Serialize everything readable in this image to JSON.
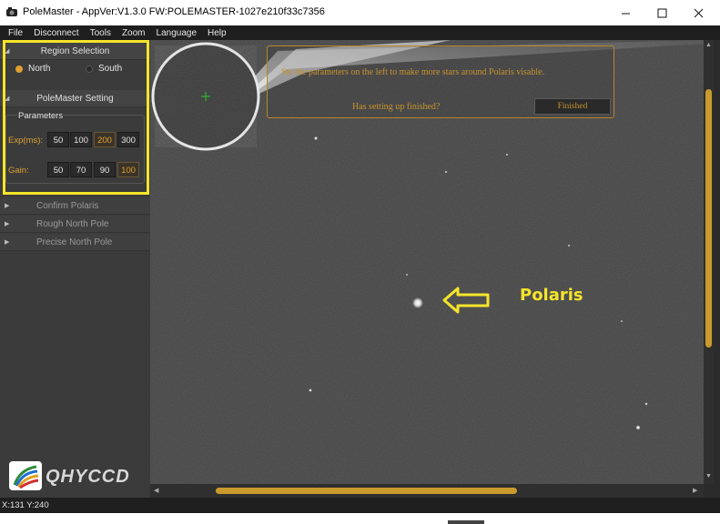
{
  "window": {
    "title": "PoleMaster - AppVer:V1.3.0 FW:POLEMASTER-1027e210f33c7356",
    "icons": [
      "app-icon",
      "minimize-icon",
      "maximize-icon",
      "close-icon"
    ]
  },
  "menu": [
    "File",
    "Disconnect",
    "Tools",
    "Zoom",
    "Language",
    "Help"
  ],
  "sidebar": {
    "region_header": "Region Selection",
    "regions": [
      {
        "label": "North",
        "selected": true
      },
      {
        "label": "South",
        "selected": false
      }
    ],
    "setting_header": "PoleMaster Setting",
    "parameters_label": "Parameters",
    "exp_label": "Exp(ms):",
    "exp_values": [
      "50",
      "100",
      "200",
      "300"
    ],
    "exp_selected": "200",
    "gain_label": "Gain:",
    "gain_values": [
      "50",
      "70",
      "90",
      "100"
    ],
    "gain_selected": "100",
    "steps": [
      "Confirm Polaris",
      "Rough North Pole",
      "Precise North Pole"
    ],
    "logo_text": "QHYCCD"
  },
  "main": {
    "instruction": "Set the parameters on the left to make more stars around Polaris visable.",
    "setup_question": "Has setting up finished?",
    "finished_button": "Finished",
    "polaris_label": "Polaris"
  },
  "status": {
    "coords": "X:131 Y:240"
  },
  "colors": {
    "accent": "#c8922e",
    "highlight": "#f5e52a",
    "scroll_thumb": "#c99a2c"
  }
}
